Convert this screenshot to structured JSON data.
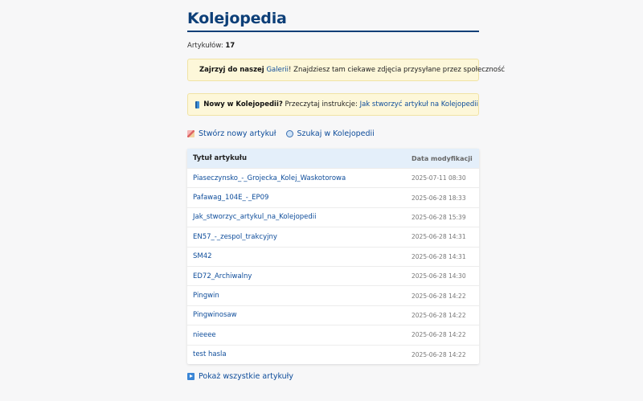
{
  "site_title": "Kolejopedia",
  "article_count": {
    "label": "Artykułów:",
    "value": "17"
  },
  "notices": [
    {
      "icon": "gallery-icon",
      "bold": "Zajrzyj do naszej",
      "link": "Galerii",
      "rest": "! Znajdziesz tam ciekawe zdjęcia przysyłane przez społeczność"
    },
    {
      "icon": "book-icon",
      "bold": "Nowy w Kolejopedii?",
      "rest": " Przeczytaj instrukcje: ",
      "link": "Jak stworzyć artykuł na Kolejopedii"
    }
  ],
  "actions": {
    "create_label": "Stwórz nowy artykuł",
    "search_label": "Szukaj w Kolejopedii"
  },
  "table": {
    "col_title": "Tytuł artykułu",
    "col_date": "Data modyfikacji",
    "rows": [
      {
        "title": "Piaseczynsko_-_Grojecka_Kolej_Waskotorowa",
        "date": "2025-07-11 08:30"
      },
      {
        "title": "Pafawag_104E_-_EP09",
        "date": "2025-06-28 18:33"
      },
      {
        "title": "Jak_stworzyc_artykul_na_Kolejopedii",
        "date": "2025-06-28 15:39"
      },
      {
        "title": "EN57_-_zespol_trakcyjny",
        "date": "2025-06-28 14:31"
      },
      {
        "title": "SM42",
        "date": "2025-06-28 14:31"
      },
      {
        "title": "ED72_Archiwalny",
        "date": "2025-06-28 14:30"
      },
      {
        "title": "Pingwin",
        "date": "2025-06-28 14:22"
      },
      {
        "title": "Pingwinosaw",
        "date": "2025-06-28 14:22"
      },
      {
        "title": "nieeee",
        "date": "2025-06-28 14:22"
      },
      {
        "title": "test hasla",
        "date": "2025-06-28 14:22"
      }
    ]
  },
  "show_all_label": "Pokaż wszystkie artykuły"
}
